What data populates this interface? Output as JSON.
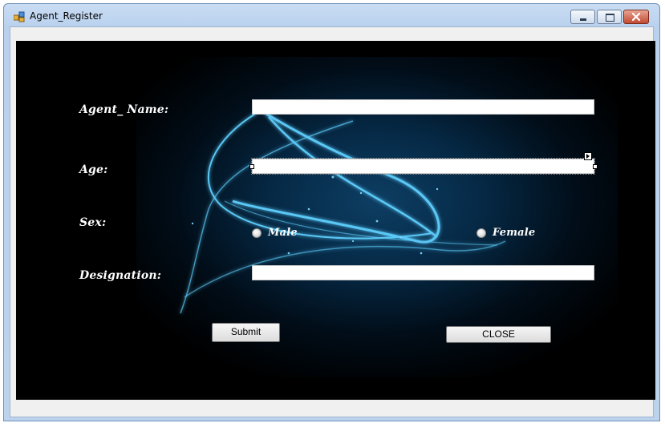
{
  "window": {
    "title": "Agent_Register",
    "controls": {
      "minimize": "minimize-icon",
      "maximize": "maximize-icon",
      "close": "close-icon"
    }
  },
  "form": {
    "agent_name_label": "Agent_ Name:",
    "agent_name_value": "",
    "age_label": "Age:",
    "age_value": "",
    "sex_label": "Sex:",
    "sex_options": [
      "Male",
      "Female"
    ],
    "designation_label": "Designation:",
    "designation_value": "",
    "submit_label": "Submit",
    "close_label": "CLOSE"
  },
  "colors": {
    "background": "#000000",
    "glow": "#4fc3ff",
    "label_text": "#ffffff",
    "title_bar": "#c9dcf2"
  }
}
